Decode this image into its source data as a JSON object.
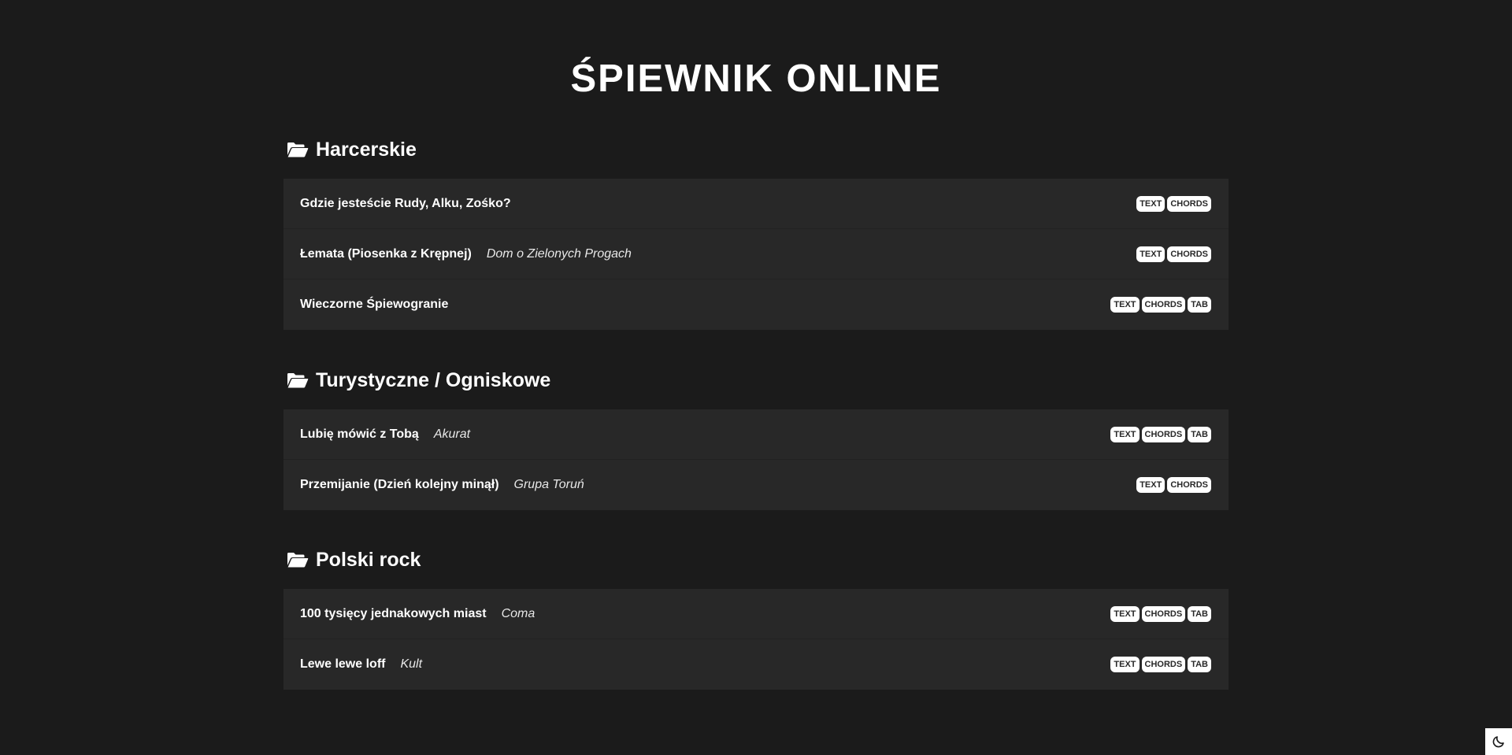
{
  "site": {
    "title": "ŚPIEWNIK ONLINE"
  },
  "icons": {
    "category": "folder-open-icon",
    "theme": "moon-icon"
  },
  "colors": {
    "background": "#1b1b1b",
    "panel": "#282828",
    "text": "#ffffff",
    "badge_bg": "#ffffff",
    "badge_text": "#282828"
  },
  "categories": [
    {
      "title": "Harcerskie",
      "songs": [
        {
          "title": "Gdzie jesteście Rudy, Alku, Zośko?",
          "artist": "",
          "badges": [
            "TEXT",
            "CHORDS"
          ]
        },
        {
          "title": "Łemata (Piosenka z Krępnej)",
          "artist": "Dom o Zielonych Progach",
          "badges": [
            "TEXT",
            "CHORDS"
          ]
        },
        {
          "title": "Wieczorne Śpiewogranie",
          "artist": "",
          "badges": [
            "TEXT",
            "CHORDS",
            "TAB"
          ]
        }
      ]
    },
    {
      "title": "Turystyczne / Ogniskowe",
      "songs": [
        {
          "title": "Lubię mówić z Tobą",
          "artist": "Akurat",
          "badges": [
            "TEXT",
            "CHORDS",
            "TAB"
          ]
        },
        {
          "title": "Przemijanie (Dzień kolejny minął)",
          "artist": "Grupa Toruń",
          "badges": [
            "TEXT",
            "CHORDS"
          ]
        }
      ]
    },
    {
      "title": "Polski rock",
      "songs": [
        {
          "title": "100 tysięcy jednakowych miast",
          "artist": "Coma",
          "badges": [
            "TEXT",
            "CHORDS",
            "TAB"
          ]
        },
        {
          "title": "Lewe lewe loff",
          "artist": "Kult",
          "badges": [
            "TEXT",
            "CHORDS",
            "TAB"
          ]
        }
      ]
    }
  ]
}
